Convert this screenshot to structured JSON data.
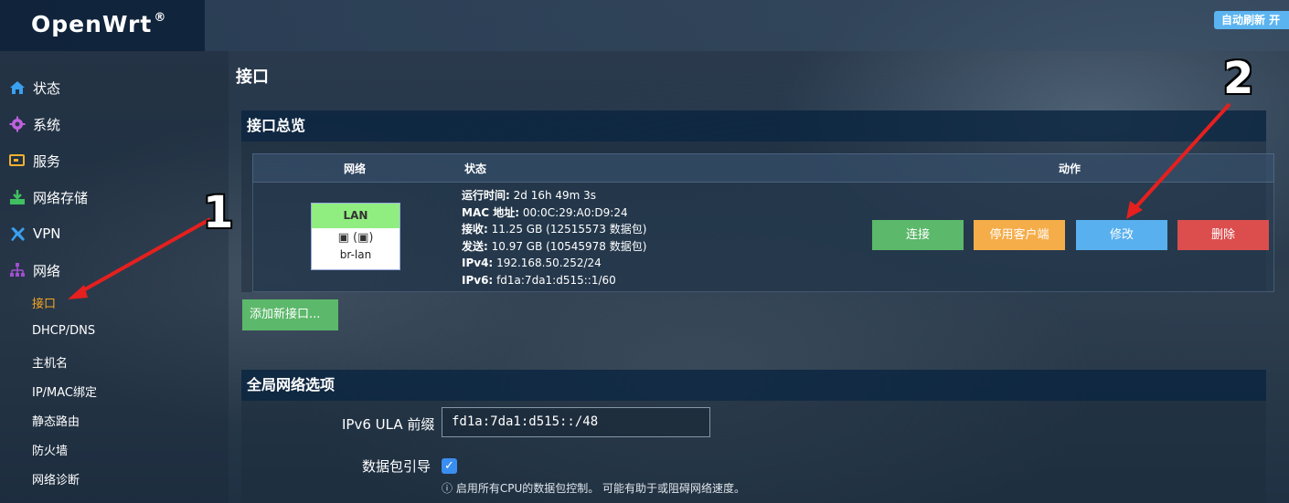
{
  "header": {
    "brand": "OpenWrt",
    "brand_sup": "®",
    "refresh_badge": "自动刷新 开"
  },
  "sidebar": {
    "items": [
      {
        "label": "状态",
        "icon": "home-icon"
      },
      {
        "label": "系统",
        "icon": "gear-icon"
      },
      {
        "label": "服务",
        "icon": "service-icon"
      },
      {
        "label": "网络存储",
        "icon": "storage-icon"
      },
      {
        "label": "VPN",
        "icon": "vpn-icon"
      },
      {
        "label": "网络",
        "icon": "network-icon"
      }
    ],
    "network_subitems": [
      {
        "label": "接口",
        "active": true
      },
      {
        "label": "DHCP/DNS"
      },
      {
        "label": "主机名"
      },
      {
        "label": "IP/MAC绑定"
      },
      {
        "label": "静态路由"
      },
      {
        "label": "防火墙"
      },
      {
        "label": "网络诊断"
      }
    ]
  },
  "main": {
    "page_title": "接口",
    "overview": {
      "title": "接口总览",
      "columns": [
        "网络",
        "状态",
        "动作"
      ],
      "interface": {
        "name": "LAN",
        "device": "br-lan",
        "status": {
          "uptime_label": "运行时间:",
          "uptime": "2d 16h 49m 3s",
          "mac_label": "MAC 地址:",
          "mac": "00:0C:29:A0:D9:24",
          "rx_label": "接收:",
          "rx": "11.25 GB (12515573 数据包)",
          "tx_label": "发送:",
          "tx": "10.97 GB (10545978 数据包)",
          "ipv4_label": "IPv4:",
          "ipv4": "192.168.50.252/24",
          "ipv6_label": "IPv6:",
          "ipv6": "fd1a:7da1:d515::1/60"
        },
        "actions": {
          "connect": "连接",
          "stop": "停用客户端",
          "edit": "修改",
          "delete": "删除"
        }
      },
      "add_button": "添加新接口..."
    },
    "global": {
      "title": "全局网络选项",
      "ula_label": "IPv6 ULA 前缀",
      "ula_value": "fd1a:7da1:d515::/48",
      "packet_steering_label": "数据包引导",
      "packet_steering_checked": true,
      "packet_steering_hint": "启用所有CPU的数据包控制。 可能有助于或阻碍网络速度。"
    }
  },
  "annotations": {
    "marker_1": "1",
    "marker_2": "2"
  },
  "colors": {
    "accent_active": "#f5a623",
    "connect": "#5cb86a",
    "stop": "#f5ad4a",
    "edit": "#58b0ee",
    "delete": "#dc4e4e",
    "annotation_arrow": "#e5201e"
  }
}
